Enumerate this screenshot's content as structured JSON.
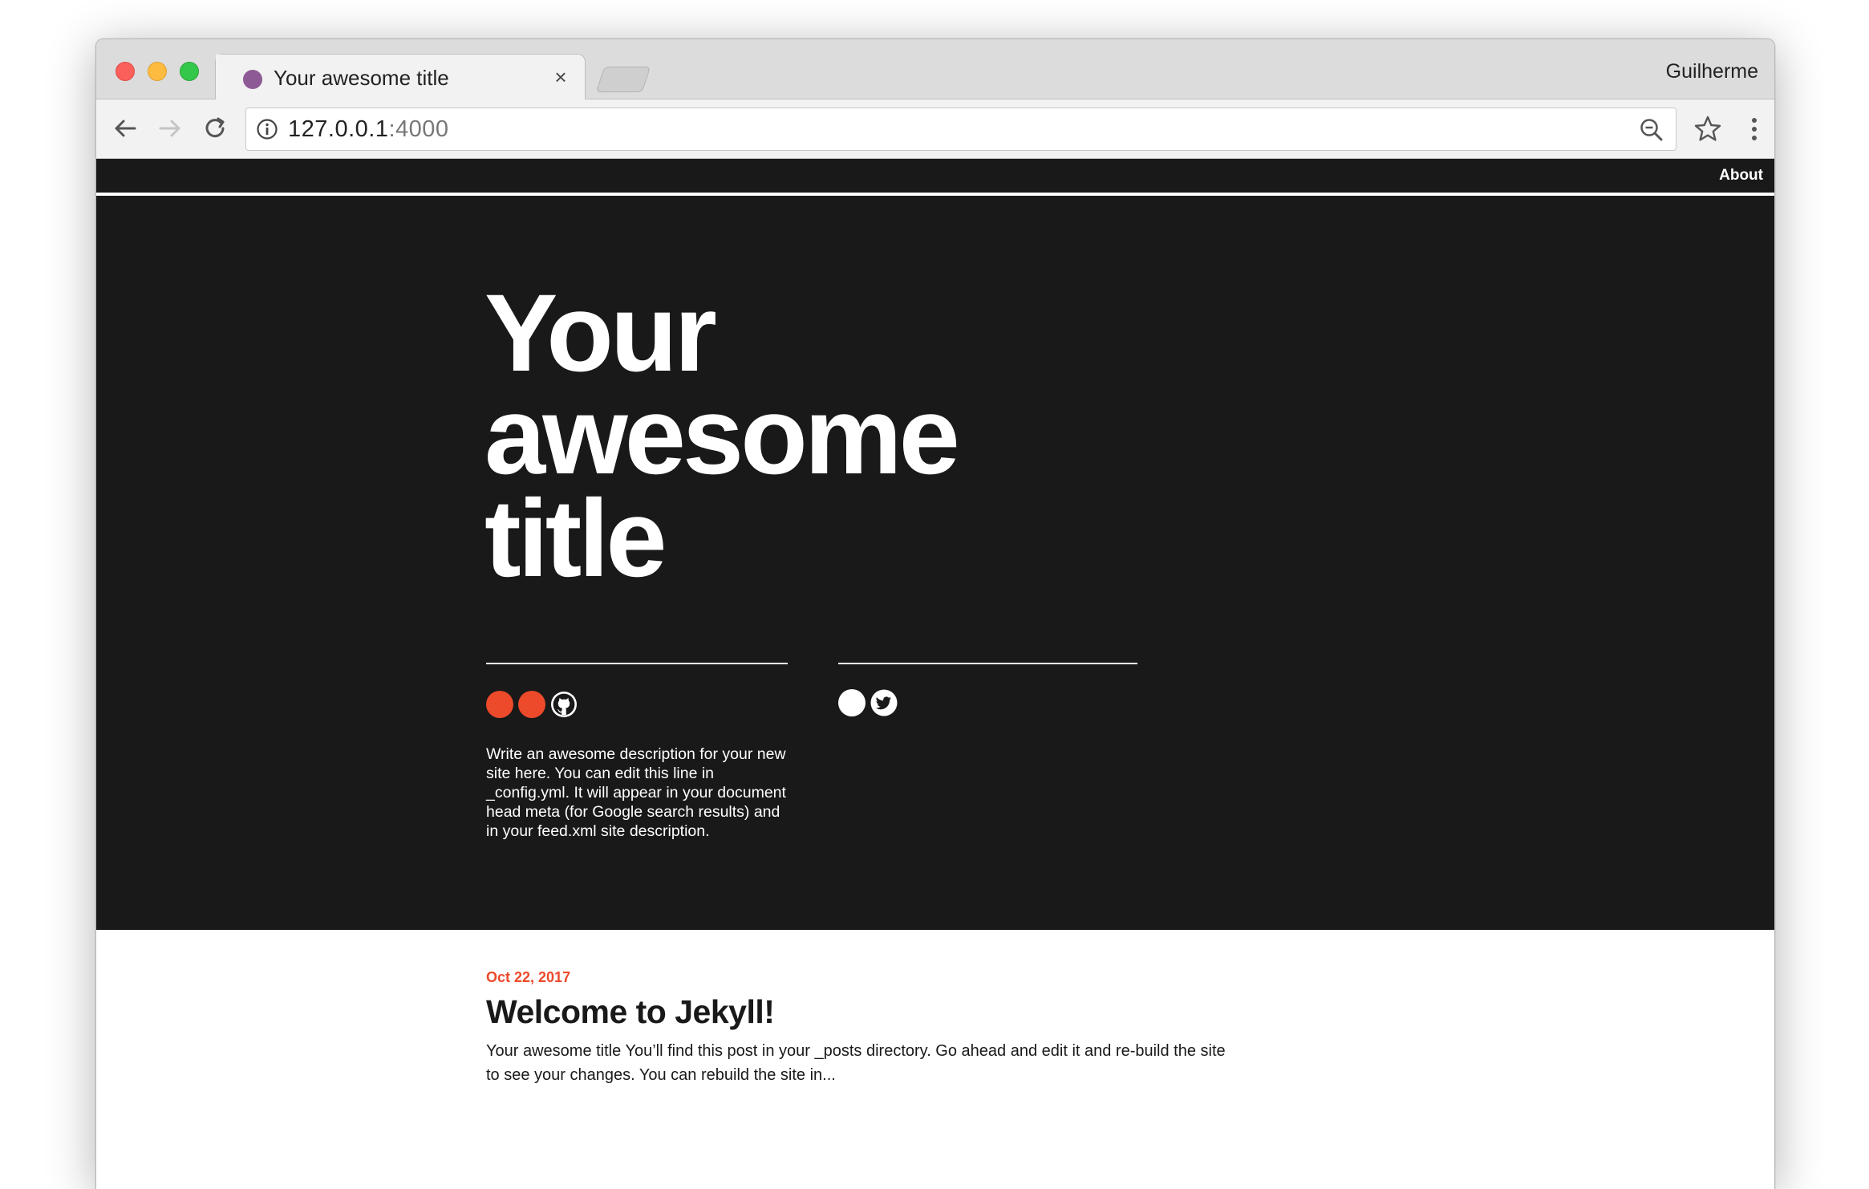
{
  "browser": {
    "tab_title": "Your awesome title",
    "tab_close": "×",
    "profile_name": "Guilherme",
    "url_host": "127.0.0.1",
    "url_port": ":4000",
    "favicon_color": "#8e5a95"
  },
  "site": {
    "nav": {
      "about_label": "About"
    },
    "hero": {
      "title_line1": "Your",
      "title_line2": "awesome",
      "title_line3": "title",
      "description": "Write an awesome description for your new site here. You can edit this line in _config.yml. It will appear in your document head meta (for Google search results) and in your feed.xml site description.",
      "left_social_icons": [
        "orange-dot",
        "orange-dot",
        "github-icon"
      ],
      "right_social_icons": [
        "white-dot",
        "twitter-icon"
      ]
    },
    "post": {
      "date": "Oct 22, 2017",
      "title": "Welcome to Jekyll!",
      "excerpt": "Your awesome title You’ll find this post in your _posts directory. Go ahead and edit it and re-build the site to see your changes. You can rebuild the site in..."
    }
  },
  "colors": {
    "hero_background": "#191919",
    "accent": "#ec4a2b",
    "text_light": "#ffffff",
    "text_dark": "#191919"
  }
}
